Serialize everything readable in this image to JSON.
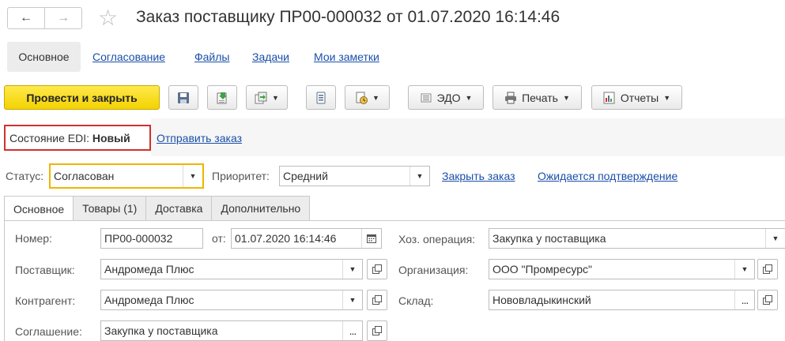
{
  "header": {
    "back_icon": "arrow-left-icon",
    "forward_icon": "arrow-right-icon",
    "favorite_icon": "star-icon",
    "title": "Заказ поставщику ПР00-000032 от 01.07.2020 16:14:46"
  },
  "nav": {
    "items": [
      {
        "label": "Основное",
        "active": true
      },
      {
        "label": "Согласование"
      },
      {
        "label": "Файлы"
      },
      {
        "label": "Задачи"
      },
      {
        "label": "Мои заметки"
      }
    ]
  },
  "toolbar": {
    "post_close": "Провести и закрыть",
    "edo": "ЭДО",
    "print": "Печать",
    "reports": "Отчеты"
  },
  "edi": {
    "state_label": "Состояние EDI:",
    "state_value": "Новый",
    "send_link": "Отправить заказ"
  },
  "status_row": {
    "status_label": "Статус:",
    "status_value": "Согласован",
    "priority_label": "Приоритет:",
    "priority_value": "Средний",
    "close_order_link": "Закрыть заказ",
    "awaiting_link": "Ожидается подтверждение"
  },
  "tabs": [
    {
      "label": "Основное",
      "active": true
    },
    {
      "label": "Товары (1)"
    },
    {
      "label": "Доставка"
    },
    {
      "label": "Дополнительно"
    }
  ],
  "form": {
    "number_label": "Номер:",
    "number_value": "ПР00-000032",
    "date_label": "от:",
    "date_value": "01.07.2020 16:14:46",
    "operation_label": "Хоз. операция:",
    "operation_value": "Закупка у поставщика",
    "supplier_label": "Поставщик:",
    "supplier_value": "Андромеда Плюс",
    "organization_label": "Организация:",
    "organization_value": "ООО \"Промресурс\"",
    "contractor_label": "Контрагент:",
    "contractor_value": "Андромеда Плюс",
    "warehouse_label": "Склад:",
    "warehouse_value": "Нововладыкинский",
    "agreement_label": "Соглашение:",
    "agreement_value": "Закупка у поставщика"
  }
}
